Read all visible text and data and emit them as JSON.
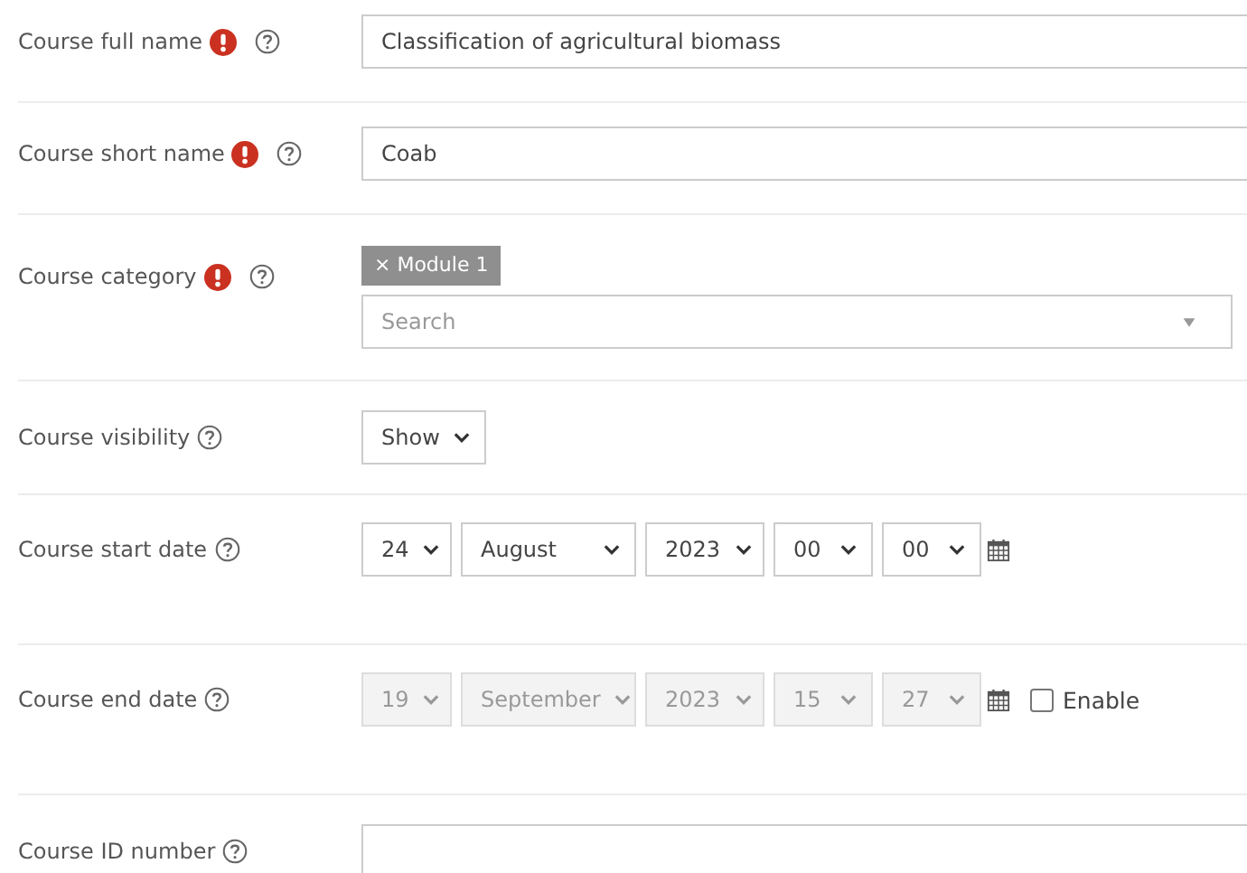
{
  "fields": [
    {
      "kind": "text",
      "label": "Course full name",
      "required": true,
      "help": true,
      "value": "Classification of agricultural biomass"
    },
    {
      "kind": "text",
      "label": "Course short name",
      "required": true,
      "help": true,
      "value": "Coab"
    },
    {
      "kind": "autocomplete",
      "label": "Course category",
      "required": true,
      "help": true,
      "tags": [
        "× Module 1"
      ],
      "placeholder": "Search"
    },
    {
      "kind": "select",
      "label": "Course visibility",
      "required": false,
      "help": true,
      "value": "Show"
    },
    {
      "kind": "date",
      "label": "Course start date",
      "required": false,
      "help": true,
      "disabled": false,
      "parts": [
        "24",
        "August",
        "2023",
        "00",
        "00"
      ]
    },
    {
      "kind": "date",
      "label": "Course end date",
      "required": false,
      "help": true,
      "disabled": true,
      "parts": [
        "19",
        "September",
        "2023",
        "15",
        "27"
      ],
      "enable": {
        "label": "Enable",
        "checked": false
      }
    },
    {
      "kind": "text",
      "label": "Course ID number",
      "required": false,
      "help": true
    }
  ]
}
